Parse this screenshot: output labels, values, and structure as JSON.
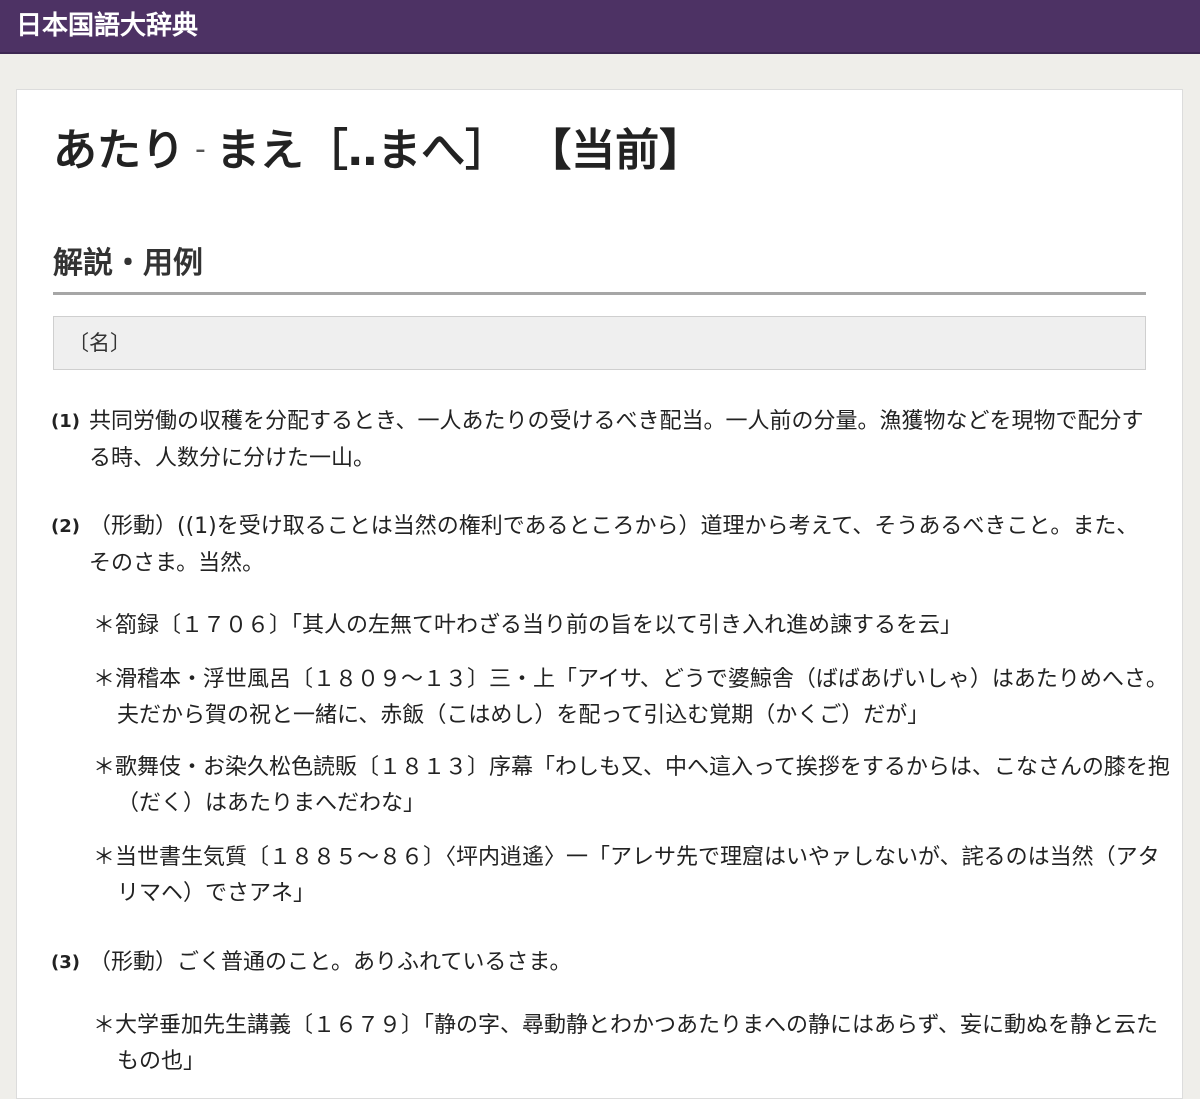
{
  "site": {
    "title": "日本国語大辞典"
  },
  "entry": {
    "reading_a": "あたり",
    "separator": "-",
    "reading_b": "まえ",
    "historical_kana": "［‥まへ］",
    "kanji": "【当前】"
  },
  "section": {
    "title": "解説・用例"
  },
  "pos": {
    "label": "〔名〕"
  },
  "senses": [
    {
      "num": "(1)",
      "text": "共同労働の収穫を分配するとき、一人あたりの受けるべき配当。一人前の分量。漁獲物などを現物で配分する時、人数分に分けた一山。"
    },
    {
      "num": "(2)",
      "text": "（形動）((1)を受け取ることは当然の権利であるところから）道理から考えて、そうあるべきこと。また、そのさま。当然。"
    },
    {
      "num": "(3)",
      "text": "（形動）ごく普通のこと。ありふれているさま。"
    }
  ],
  "examples": [
    "＊箚録〔１７０６〕「其人の左無て叶わざる当り前の旨を以て引き入れ進め諫するを云」",
    "＊滑稽本・浮世風呂〔１８０９〜１３〕三・上「アイサ、どうで婆鯨舎（ばばあげいしゃ）はあたりめへさ。夫だから賀の祝と一緒に、赤飯（こはめし）を配って引込む覚期（かくご）だが」",
    "＊歌舞伎・お染久松色読販〔１８１３〕序幕「わしも又、中へ這入って挨拶をするからは、こなさんの膝を抱（だく）はあたりまへだわな」",
    "＊当世書生気質〔１８８５〜８６〕〈坪内逍遙〉一「アレサ先で理窟はいやァしないが、詫るのは当然（アタリマヘ）でさアネ」",
    "＊大学垂加先生講義〔１６７９〕「静の字、尋動静とわかつあたりまへの静にはあらず、妄に動ぬを静と云たもの也」"
  ]
}
